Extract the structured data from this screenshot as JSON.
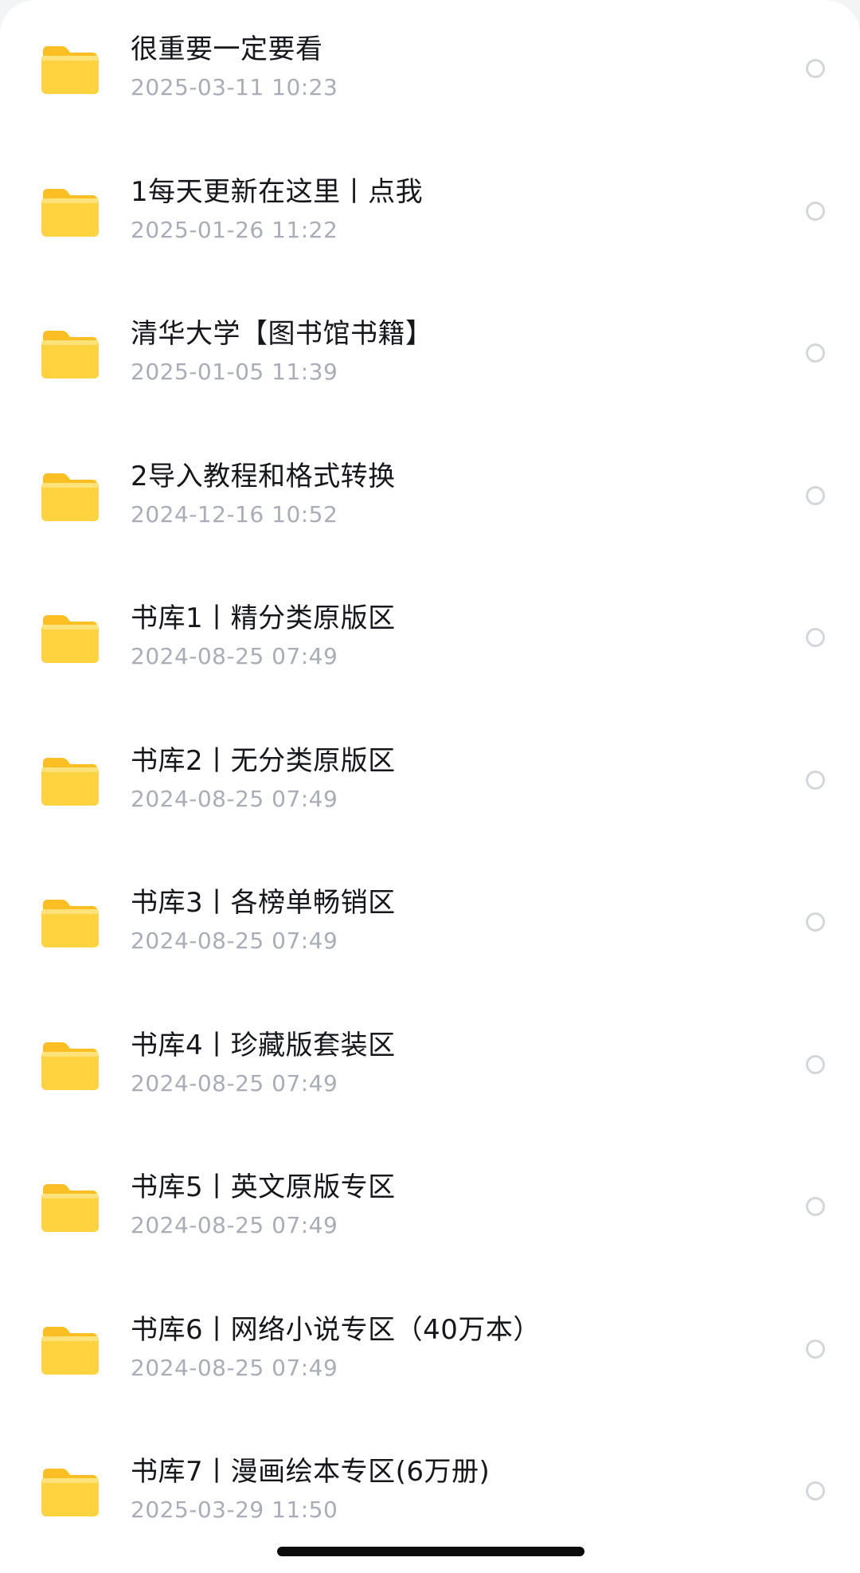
{
  "folders": [
    {
      "name": "很重要一定要看",
      "date": "2025-03-11 10:23"
    },
    {
      "name": "1每天更新在这里丨点我",
      "date": "2025-01-26 11:22"
    },
    {
      "name": "清华大学【图书馆书籍】",
      "date": "2025-01-05 11:39"
    },
    {
      "name": "2导入教程和格式转换",
      "date": "2024-12-16 10:52"
    },
    {
      "name": "书库1丨精分类原版区",
      "date": "2024-08-25 07:49"
    },
    {
      "name": "书库2丨无分类原版区",
      "date": "2024-08-25 07:49"
    },
    {
      "name": "书库3丨各榜单畅销区",
      "date": "2024-08-25 07:49"
    },
    {
      "name": "书库4丨珍藏版套装区",
      "date": "2024-08-25 07:49"
    },
    {
      "name": "书库5丨英文原版专区",
      "date": "2024-08-25 07:49"
    },
    {
      "name": "书库6丨网络小说专区（40万本）",
      "date": "2024-08-25 07:49"
    },
    {
      "name": "书库7丨漫画绘本专区(6万册)",
      "date": "2025-03-29 11:50"
    }
  ],
  "icons": {
    "folder": "folder-icon",
    "select": "radio-circle-icon"
  },
  "colors": {
    "folder_body": "#ffd23f",
    "folder_tab": "#fbbf24",
    "name_text": "#15171c",
    "date_text": "#a8adb7",
    "radio_border": "#d3d6db"
  }
}
